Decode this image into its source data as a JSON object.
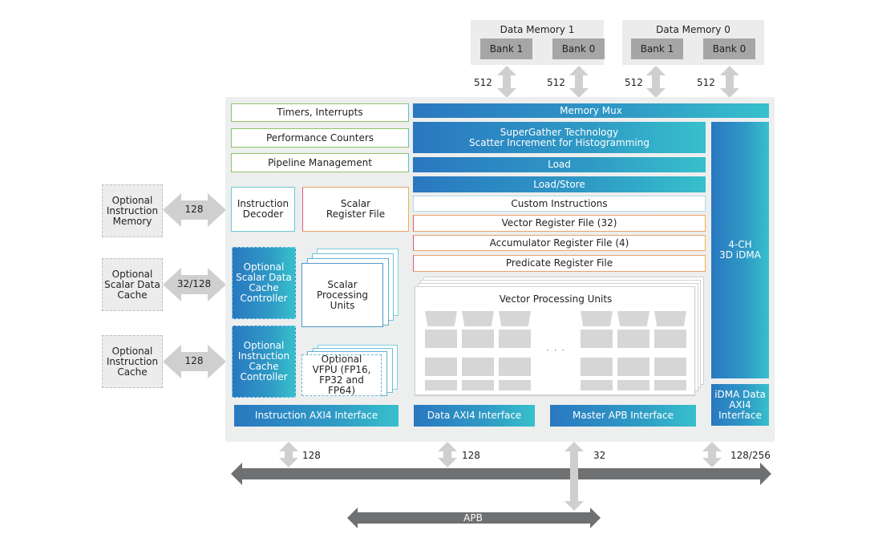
{
  "memories": [
    {
      "title": "Data Memory 1",
      "banks": [
        "Bank 1",
        "Bank 0"
      ],
      "widths": [
        "512",
        "512"
      ]
    },
    {
      "title": "Data Memory 0",
      "banks": [
        "Bank 1",
        "Bank 0"
      ],
      "widths": [
        "512",
        "512"
      ]
    }
  ],
  "core": {
    "timers": "Timers, Interrupts",
    "perf": "Performance Counters",
    "pipeline": "Pipeline Management",
    "decoder": "Instruction Decoder",
    "scalar_rf": "Scalar Register File",
    "sdc_ctrl": "Optional Scalar Data Cache Controller",
    "ic_ctrl": "Optional Instruction Cache Controller",
    "spu": "Scalar Processing Units",
    "vfpu": "Optional VFPU (FP16, FP32 and FP64)",
    "memory_mux": "Memory Mux",
    "supergather_1": "SuperGather Technology",
    "supergather_2": "Scatter Increment for Histogramming",
    "load": "Load",
    "load_store": "Load/Store",
    "custom": "Custom Instructions",
    "vrf": "Vector Register File (32)",
    "arf": "Accumulator Register File (4)",
    "prf": "Predicate Register File",
    "vpu": "Vector Processing Units",
    "vpu_ellipsis": "· · ·",
    "idma_1": "4-CH",
    "idma_2": "3D iDMA",
    "idma_if_1": "iDMA Data",
    "idma_if_2": "AXI4",
    "idma_if_3": "Interface",
    "instr_axi": "Instruction AXI4 Interface",
    "data_axi": "Data AXI4 Interface",
    "apb_if": "Master APB Interface"
  },
  "external": [
    {
      "label_1": "Optional",
      "label_2": "Instruction",
      "label_3": "Memory",
      "width": "128"
    },
    {
      "label_1": "Optional",
      "label_2": "Scalar Data",
      "label_3": "Cache",
      "width": "32/128"
    },
    {
      "label_1": "Optional",
      "label_2": "Instruction",
      "label_3": "Cache",
      "width": "128"
    }
  ],
  "bus": {
    "widths": [
      "128",
      "128",
      "32",
      "128/256"
    ],
    "apb_label": "APB"
  }
}
